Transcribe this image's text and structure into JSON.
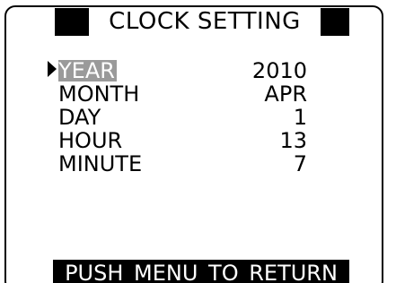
{
  "screen": {
    "title": "CLOCK SETTING",
    "footer": "PUSH MENU TO RETURN"
  },
  "menu": {
    "items": [
      {
        "label": "YEAR",
        "value": "2010",
        "selected": true
      },
      {
        "label": "MONTH",
        "value": "APR",
        "selected": false
      },
      {
        "label": "DAY",
        "value": "1",
        "selected": false
      },
      {
        "label": "HOUR",
        "value": "13",
        "selected": false
      },
      {
        "label": "MINUTE",
        "value": "7",
        "selected": false
      }
    ]
  },
  "icons": {
    "cursor": "right-triangle-icon"
  },
  "colors": {
    "background": "#ffffff",
    "foreground": "#000000",
    "highlight": "#9a9a9a"
  }
}
